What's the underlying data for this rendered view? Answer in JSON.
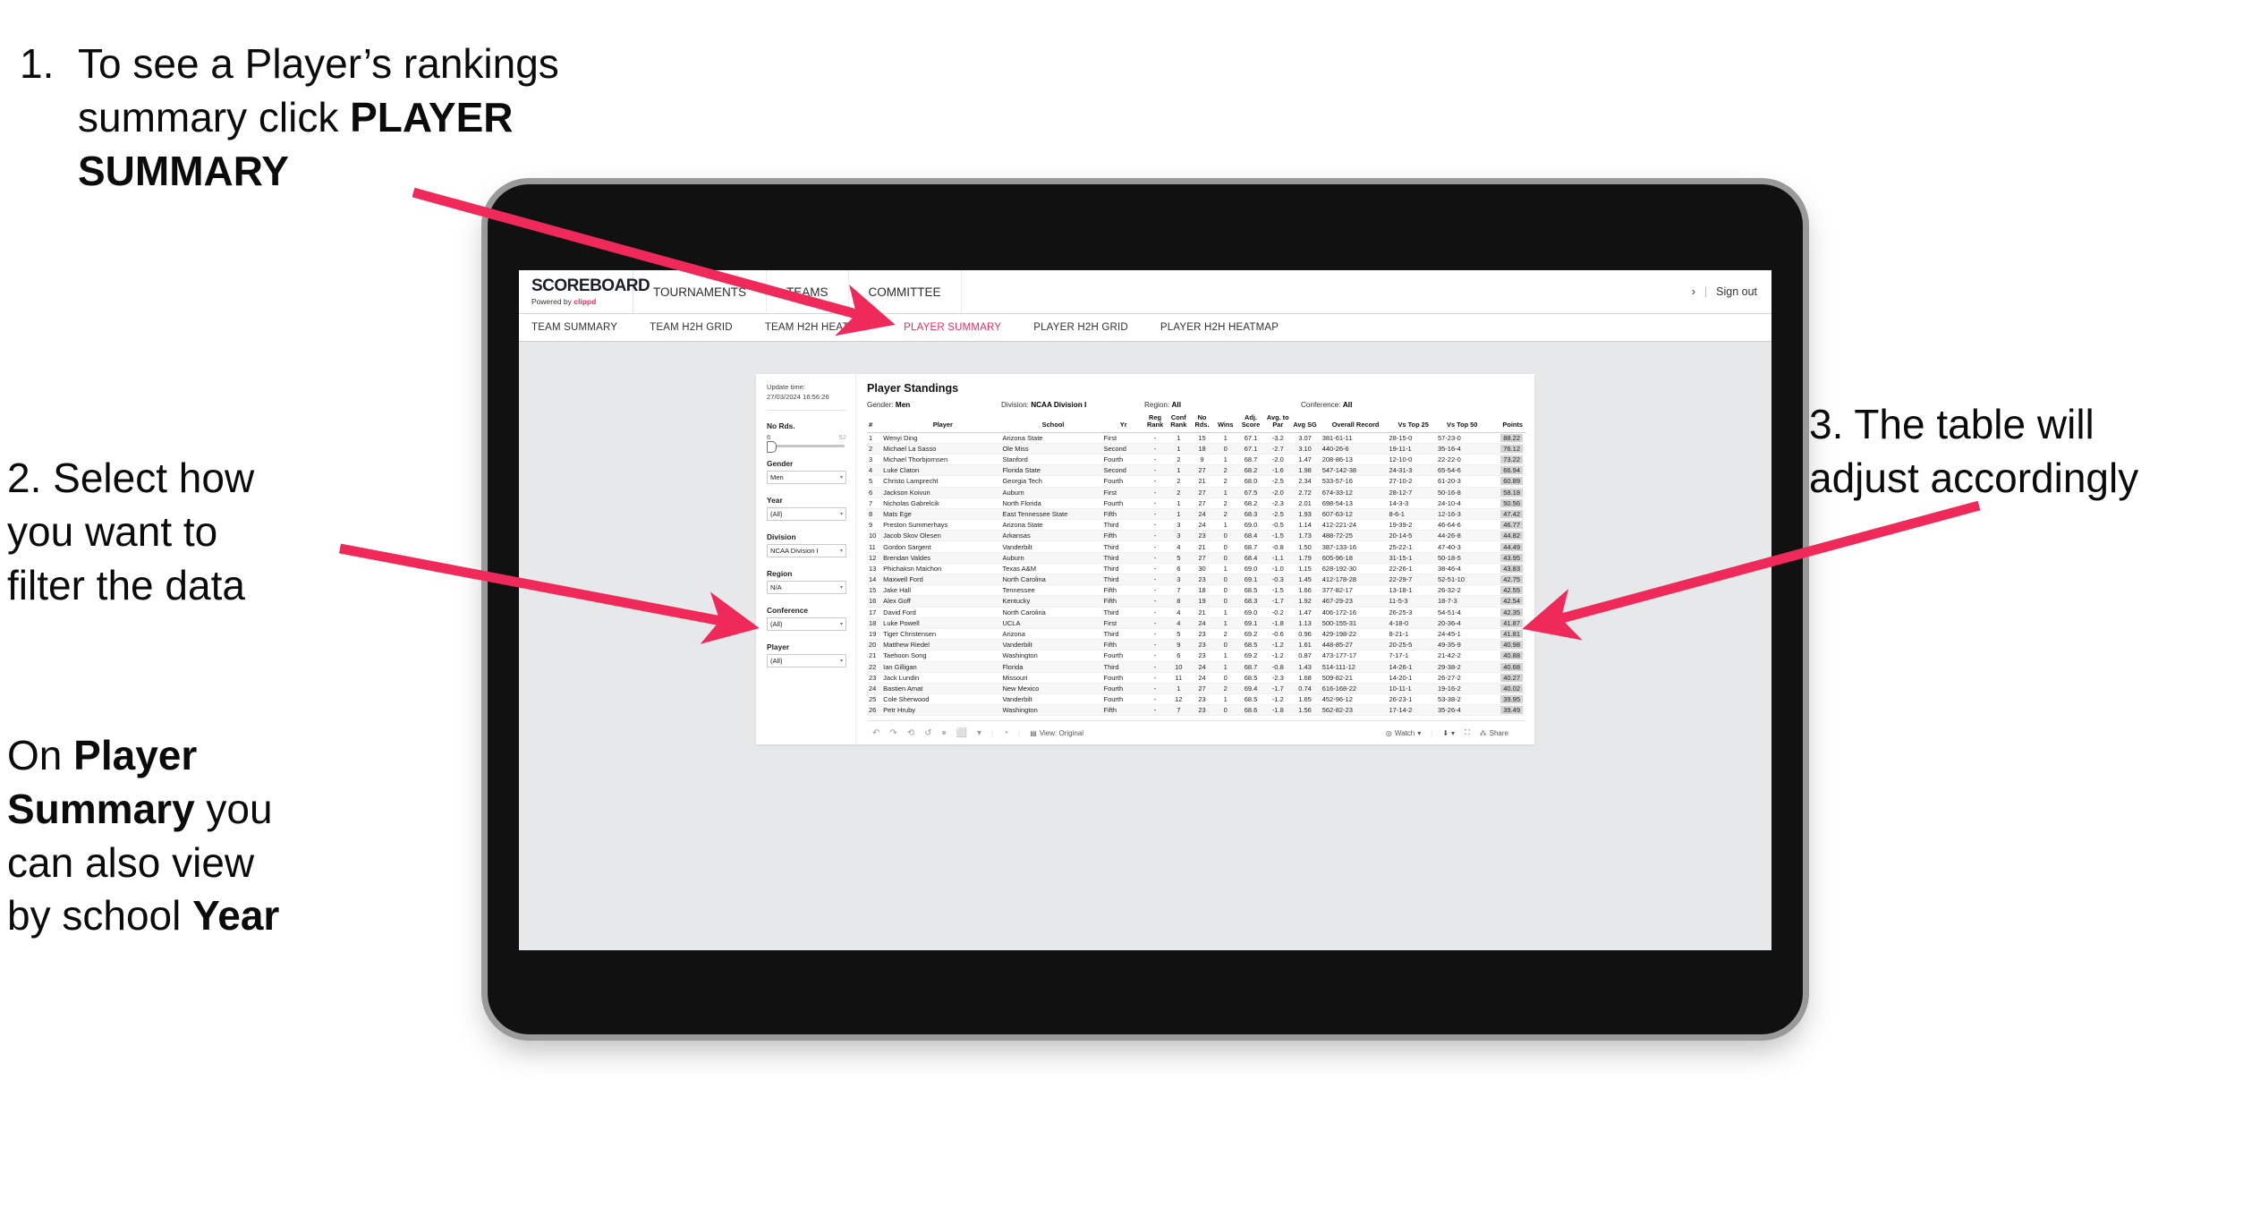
{
  "annotations": {
    "step1_num": "1.",
    "step1_a": "To see a Player’s rankings",
    "step1_b": "summary click ",
    "step1_bold": "PLAYER SUMMARY",
    "step2_l1": "2. Select how",
    "step2_l2": "you want to",
    "step2_l3": "filter the data",
    "step2b_l1_a": "On ",
    "step2b_l1_b": "Player",
    "step2b_l2_b": "Summary",
    "step2b_l2_a": " you",
    "step2b_l3": "can also view",
    "step2b_l4_a": "by school ",
    "step2b_l4_b": "Year",
    "step3_l1": "3. The table will",
    "step3_l2": "adjust accordingly",
    "arrow_color": "#ef2a5b"
  },
  "app": {
    "brand": {
      "logo": "SCOREBOARD",
      "powered_prefix": "Powered by ",
      "powered_brand": "clippd"
    },
    "topnav": [
      "TOURNAMENTS",
      "TEAMS",
      "COMMITTEE"
    ],
    "topright": {
      "chevron": "›",
      "sep": "|",
      "signout": "Sign out"
    },
    "subnav": [
      {
        "label": "TEAM SUMMARY",
        "active": false
      },
      {
        "label": "TEAM H2H GRID",
        "active": false
      },
      {
        "label": "TEAM H2H HEATMAP",
        "active": false
      },
      {
        "label": "PLAYER SUMMARY",
        "active": true
      },
      {
        "label": "PLAYER H2H GRID",
        "active": false
      },
      {
        "label": "PLAYER H2H HEATMAP",
        "active": false
      }
    ],
    "active_accent": "#ef2a5b"
  },
  "filters": {
    "update_label": "Update time:",
    "update_value": "27/03/2024 16:56:26",
    "slider": {
      "label": "No Rds.",
      "min": "6",
      "max": "52"
    },
    "selects": [
      {
        "label": "Gender",
        "value": "Men"
      },
      {
        "label": "Year",
        "value": "(All)"
      },
      {
        "label": "Division",
        "value": "NCAA Division I"
      },
      {
        "label": "Region",
        "value": "N/A"
      },
      {
        "label": "Conference",
        "value": "(All)"
      },
      {
        "label": "Player",
        "value": "(All)"
      }
    ]
  },
  "standings": {
    "title": "Player Standings",
    "meta": [
      {
        "label": "Gender:",
        "value": "Men"
      },
      {
        "label": "Division:",
        "value": "NCAA Division I"
      },
      {
        "label": "Region:",
        "value": "All"
      },
      {
        "label": "Conference:",
        "value": "All"
      }
    ],
    "columns": [
      "#",
      "Player",
      "School",
      "Yr",
      "Reg Rank",
      "Conf Rank",
      "No Rds.",
      "Wins",
      "Adj. Score",
      "Avg. to Par",
      "Avg SG",
      "Overall Record",
      "Vs Top 25",
      "Vs Top 50",
      "Points"
    ],
    "rows": [
      [
        "1",
        "Wenyi Ding",
        "Arizona State",
        "First",
        "-",
        "1",
        "15",
        "1",
        "67.1",
        "-3.2",
        "3.07",
        "381-61-11",
        "28-15-0",
        "57-23-0",
        "88.22"
      ],
      [
        "2",
        "Michael La Sasso",
        "Ole Miss",
        "Second",
        "-",
        "1",
        "18",
        "0",
        "67.1",
        "-2.7",
        "3.10",
        "440-26-6",
        "19-11-1",
        "35-16-4",
        "76.12"
      ],
      [
        "3",
        "Michael Thorbjornsen",
        "Stanford",
        "Fourth",
        "-",
        "2",
        "9",
        "1",
        "68.7",
        "-2.0",
        "1.47",
        "208-86-13",
        "12-10-0",
        "22-22-0",
        "73.22"
      ],
      [
        "4",
        "Luke Claton",
        "Florida State",
        "Second",
        "-",
        "1",
        "27",
        "2",
        "68.2",
        "-1.6",
        "1.98",
        "547-142-38",
        "24-31-3",
        "65-54-6",
        "66.94"
      ],
      [
        "5",
        "Christo Lamprecht",
        "Georgia Tech",
        "Fourth",
        "-",
        "2",
        "21",
        "2",
        "68.0",
        "-2.5",
        "2.34",
        "533-57-16",
        "27-10-2",
        "61-20-3",
        "60.89"
      ],
      [
        "6",
        "Jackson Koivun",
        "Auburn",
        "First",
        "-",
        "2",
        "27",
        "1",
        "67.5",
        "-2.0",
        "2.72",
        "674-33-12",
        "28-12-7",
        "50-16-8",
        "58.18"
      ],
      [
        "7",
        "Nicholas Gabrelcik",
        "North Florida",
        "Fourth",
        "-",
        "1",
        "27",
        "2",
        "68.2",
        "-2.3",
        "2.01",
        "698-54-13",
        "14-3-3",
        "24-10-4",
        "50.56"
      ],
      [
        "8",
        "Mats Ege",
        "East Tennessee State",
        "Fifth",
        "-",
        "1",
        "24",
        "2",
        "68.3",
        "-2.5",
        "1.93",
        "607-63-12",
        "8-6-1",
        "12-16-3",
        "47.42"
      ],
      [
        "9",
        "Preston Summerhays",
        "Arizona State",
        "Third",
        "-",
        "3",
        "24",
        "1",
        "69.0",
        "-0.5",
        "1.14",
        "412-221-24",
        "19-39-2",
        "46-64-6",
        "46.77"
      ],
      [
        "10",
        "Jacob Skov Olesen",
        "Arkansas",
        "Fifth",
        "-",
        "3",
        "23",
        "0",
        "68.4",
        "-1.5",
        "1.73",
        "488-72-25",
        "20-14-5",
        "44-26-8",
        "44.82"
      ],
      [
        "11",
        "Gordon Sargent",
        "Vanderbilt",
        "Third",
        "-",
        "4",
        "21",
        "0",
        "68.7",
        "-0.8",
        "1.50",
        "387-133-16",
        "25-22-1",
        "47-40-3",
        "44.49"
      ],
      [
        "12",
        "Brendan Valdes",
        "Auburn",
        "Third",
        "-",
        "5",
        "27",
        "0",
        "68.4",
        "-1.1",
        "1.79",
        "605-96-18",
        "31-15-1",
        "50-18-5",
        "43.95"
      ],
      [
        "13",
        "Phichaksn Maichon",
        "Texas A&M",
        "Third",
        "-",
        "6",
        "30",
        "1",
        "69.0",
        "-1.0",
        "1.15",
        "628-192-30",
        "22-26-1",
        "38-46-4",
        "43.83"
      ],
      [
        "14",
        "Maxwell Ford",
        "North Carolina",
        "Third",
        "-",
        "3",
        "23",
        "0",
        "69.1",
        "-0.3",
        "1.45",
        "412-178-28",
        "22-29-7",
        "52-51-10",
        "42.75"
      ],
      [
        "15",
        "Jake Hall",
        "Tennessee",
        "Fifth",
        "-",
        "7",
        "18",
        "0",
        "68.5",
        "-1.5",
        "1.66",
        "377-82-17",
        "13-18-1",
        "26-32-2",
        "42.55"
      ],
      [
        "16",
        "Alex Goff",
        "Kentucky",
        "Fifth",
        "-",
        "8",
        "19",
        "0",
        "68.3",
        "-1.7",
        "1.92",
        "467-29-23",
        "11-5-3",
        "18-7-3",
        "42.54"
      ],
      [
        "17",
        "David Ford",
        "North Carolina",
        "Third",
        "-",
        "4",
        "21",
        "1",
        "69.0",
        "-0.2",
        "1.47",
        "406-172-16",
        "26-25-3",
        "54-51-4",
        "42.35"
      ],
      [
        "18",
        "Luke Powell",
        "UCLA",
        "First",
        "-",
        "4",
        "24",
        "1",
        "69.1",
        "-1.8",
        "1.13",
        "500-155-31",
        "4-18-0",
        "20-36-4",
        "41.87"
      ],
      [
        "19",
        "Tiger Christensen",
        "Arizona",
        "Third",
        "-",
        "5",
        "23",
        "2",
        "69.2",
        "-0.6",
        "0.96",
        "429-198-22",
        "8-21-1",
        "24-45-1",
        "41.81"
      ],
      [
        "20",
        "Matthew Riedel",
        "Vanderbilt",
        "Fifth",
        "-",
        "9",
        "23",
        "0",
        "68.5",
        "-1.2",
        "1.61",
        "448-85-27",
        "20-25-5",
        "49-35-9",
        "40.98"
      ],
      [
        "21",
        "Taehoon Song",
        "Washington",
        "Fourth",
        "-",
        "6",
        "23",
        "1",
        "69.2",
        "-1.2",
        "0.87",
        "473-177-17",
        "7-17-1",
        "21-42-2",
        "40.88"
      ],
      [
        "22",
        "Ian Gilligan",
        "Florida",
        "Third",
        "-",
        "10",
        "24",
        "1",
        "68.7",
        "-0.8",
        "1.43",
        "514-111-12",
        "14-26-1",
        "29-38-2",
        "40.68"
      ],
      [
        "23",
        "Jack Lundin",
        "Missouri",
        "Fourth",
        "-",
        "11",
        "24",
        "0",
        "68.5",
        "-2.3",
        "1.68",
        "509-82-21",
        "14-20-1",
        "26-27-2",
        "40.27"
      ],
      [
        "24",
        "Bastien Amat",
        "New Mexico",
        "Fourth",
        "-",
        "1",
        "27",
        "2",
        "69.4",
        "-1.7",
        "0.74",
        "616-168-22",
        "10-11-1",
        "19-16-2",
        "40.02"
      ],
      [
        "25",
        "Cole Sherwood",
        "Vanderbilt",
        "Fourth",
        "-",
        "12",
        "23",
        "1",
        "68.5",
        "-1.2",
        "1.65",
        "452-96-12",
        "26-23-1",
        "53-38-2",
        "39.95"
      ],
      [
        "26",
        "Petr Hruby",
        "Washington",
        "Fifth",
        "-",
        "7",
        "23",
        "0",
        "68.6",
        "-1.8",
        "1.56",
        "562-82-23",
        "17-14-2",
        "35-26-4",
        "39.49"
      ]
    ]
  },
  "vizbar": {
    "undo": "↶",
    "redo": "↷",
    "revert": "⟲",
    "refresh": "↺",
    "pause": "⏸",
    "share_view": "⬜",
    "caret": "▾",
    "history": "◔",
    "view_label": "View: Original",
    "view_icon": "▤",
    "watch_label": "Watch",
    "watch_icon": "◎",
    "download_icon": "⬇",
    "fullscreen_icon": "⛶",
    "share_label": "Share",
    "share_icon": "⁂"
  }
}
